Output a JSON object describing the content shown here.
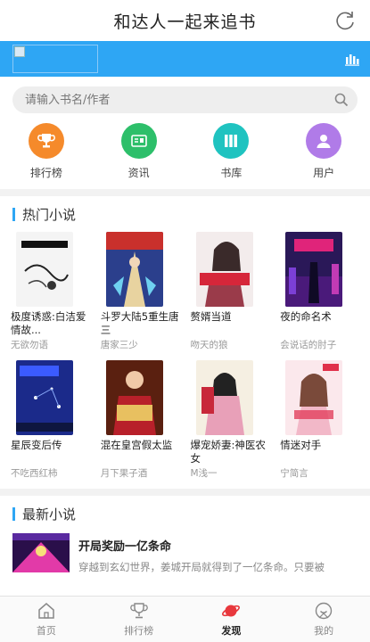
{
  "header": {
    "title": "和达人一起来追书"
  },
  "search": {
    "placeholder": "请输入书名/作者"
  },
  "quick_links": [
    {
      "label": "排行榜",
      "icon": "trophy-icon",
      "color": "#f58a2b"
    },
    {
      "label": "资讯",
      "icon": "news-icon",
      "color": "#2dbf6a"
    },
    {
      "label": "书库",
      "icon": "library-icon",
      "color": "#1fc3c0"
    },
    {
      "label": "用户",
      "icon": "user-icon",
      "color": "#b07be8"
    }
  ],
  "hot": {
    "title": "热门小说",
    "books": [
      {
        "name": "极度诱惑:白洁爱情故...",
        "author": "无欲勿语"
      },
      {
        "name": "斗罗大陆5重生唐三",
        "author": "唐家三少"
      },
      {
        "name": "赘婿当道",
        "author": "吻天的狼"
      },
      {
        "name": "夜的命名术",
        "author": "会说话的肘子"
      },
      {
        "name": "星辰变后传",
        "author": "不吃西红柿"
      },
      {
        "name": "混在皇宫假太监",
        "author": "月下果子酒"
      },
      {
        "name": "爆宠娇妻:神医农女",
        "author": "M浅一"
      },
      {
        "name": "情迷对手",
        "author": "宁简言"
      }
    ]
  },
  "latest": {
    "title": "最新小说",
    "item": {
      "name": "开局奖励一亿条命",
      "desc": "穿越到玄幻世界，姜城开局就得到了一亿条命。只要被"
    }
  },
  "tabs": [
    {
      "label": "首页",
      "icon": "home-icon"
    },
    {
      "label": "排行榜",
      "icon": "trophy-outline-icon"
    },
    {
      "label": "发现",
      "icon": "planet-icon",
      "active": true
    },
    {
      "label": "我的",
      "icon": "profile-icon"
    }
  ],
  "colors": {
    "accent": "#2ea6f4",
    "active_tab": "#e8383d"
  }
}
